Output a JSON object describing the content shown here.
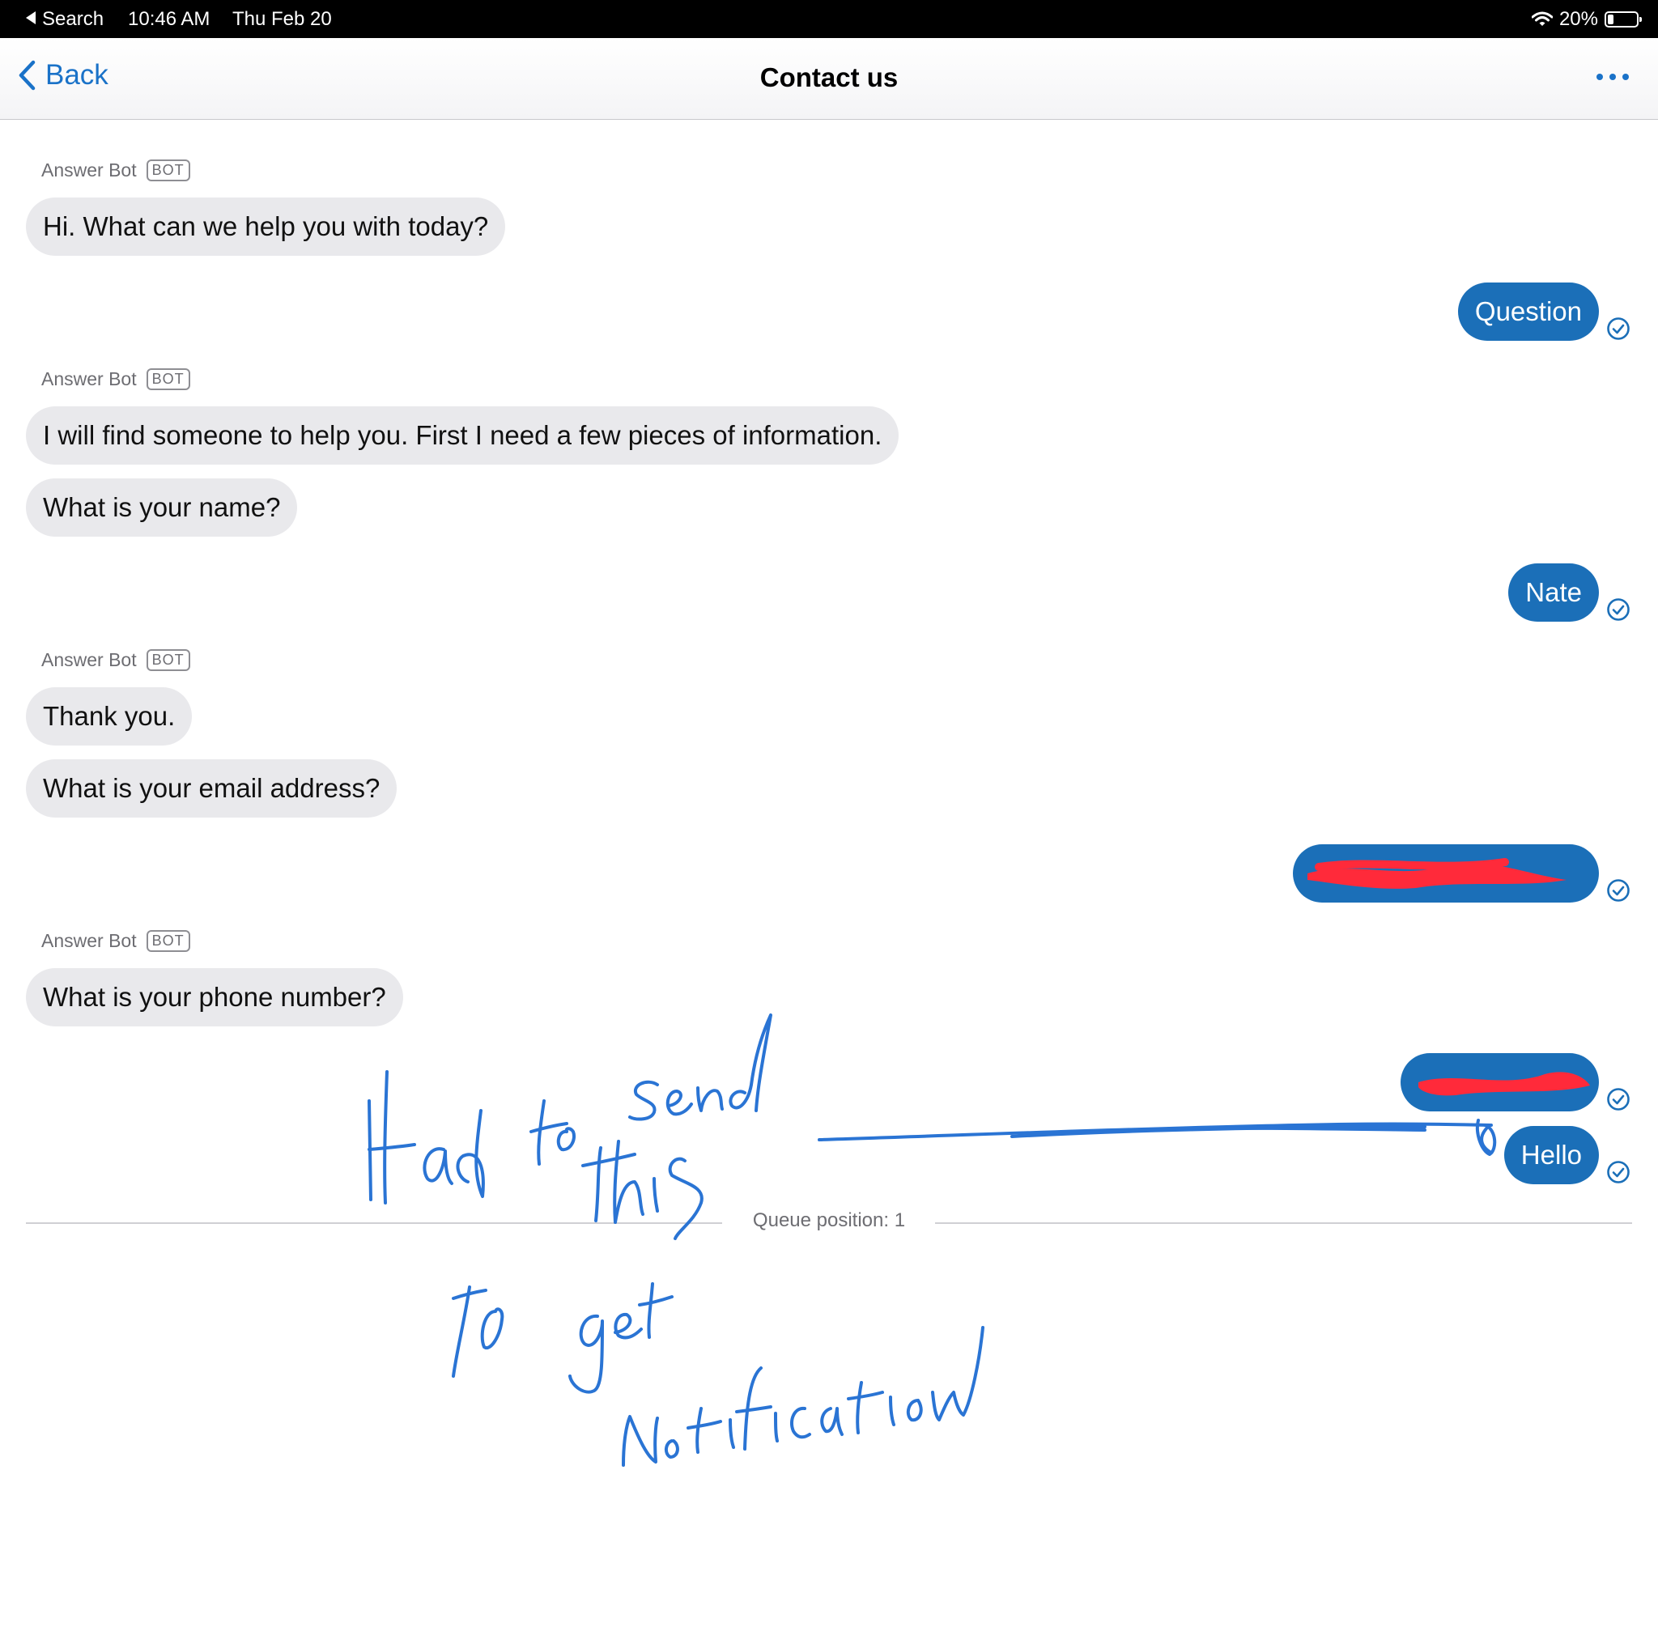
{
  "status_bar": {
    "back_label": "Search",
    "time": "10:46 AM",
    "date": "Thu Feb 20",
    "battery": "20%",
    "battery_level": 0.2
  },
  "nav": {
    "back_label": "Back",
    "title": "Contact us"
  },
  "messages": [
    {
      "sender": "Answer Bot",
      "badge": "BOT",
      "text": "Hi. What can we help you with today?"
    },
    {
      "from": "user",
      "text": "Question"
    },
    {
      "sender": "Answer Bot",
      "badge": "BOT",
      "text": "I will find someone to help you. First I need a few pieces of information."
    },
    {
      "text": "What is your name?"
    },
    {
      "from": "user",
      "text": "Nate"
    },
    {
      "sender": "Answer Bot",
      "badge": "BOT",
      "text": "Thank you."
    },
    {
      "text": "What is your email address?"
    },
    {
      "from": "user",
      "text": ""
    },
    {
      "sender": "Answer Bot",
      "badge": "BOT",
      "text": "What is your phone number?"
    },
    {
      "from": "user",
      "text": ""
    },
    {
      "from": "user",
      "text": "Hello"
    }
  ],
  "queue": {
    "label": "Queue position: 1"
  },
  "annotation": {
    "handwritten_lines": [
      "Had to send this",
      "to get",
      "notification"
    ],
    "ink_color": "#2a74d4",
    "redaction_color": "#ff2a3a"
  },
  "colors": {
    "accent": "#1a72c8",
    "user_bubble": "#1b6fb8",
    "bot_bubble": "#e9e9ec"
  }
}
